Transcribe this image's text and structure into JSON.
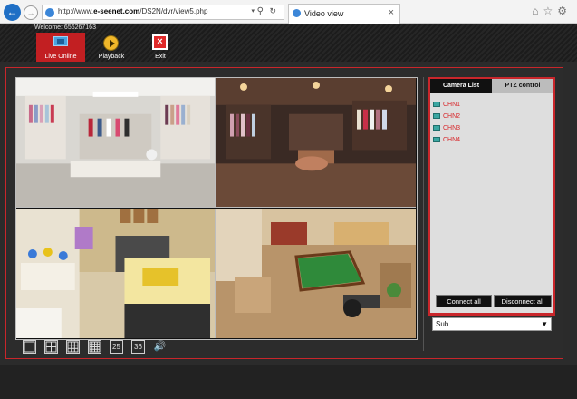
{
  "browser": {
    "url_prefix": "http://www.",
    "url_domain": "e-seenet.com",
    "url_path": "/DS2N/dvr/view5.php",
    "tab_title": "Video view"
  },
  "app": {
    "welcome": "Welcome: 656267163",
    "toolbar": {
      "live_label": "Live Online",
      "playback_label": "Playback",
      "exit_label": "Exit"
    }
  },
  "layout_bar": {
    "grid_25": "25",
    "grid_36": "36"
  },
  "side_panel": {
    "tabs": [
      "Camera List",
      "PTZ control"
    ],
    "channels": [
      "CHN1",
      "CHN2",
      "CHN3",
      "CHN4"
    ],
    "connect_all": "Connect all",
    "disconnect_all": "Disconnect all",
    "stream_value": "Sub"
  },
  "colors": {
    "accent_red": "#c9262b",
    "channel_text": "#d8292d"
  }
}
